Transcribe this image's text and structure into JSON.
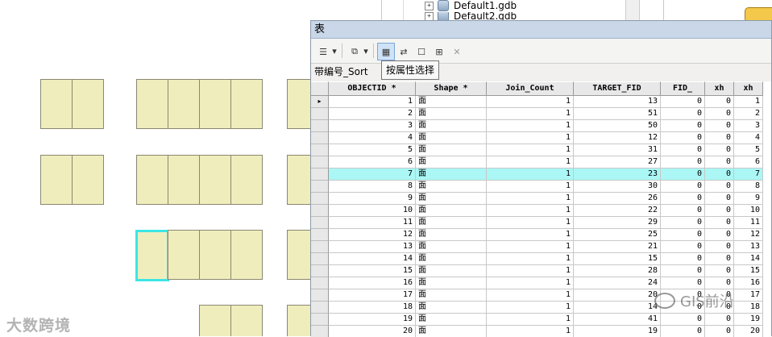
{
  "catalog_tree": {
    "items": [
      {
        "label": "Default1.gdb",
        "expand": "+"
      },
      {
        "label": "Default2.gdb",
        "expand": "+"
      }
    ]
  },
  "table_window": {
    "title": "表",
    "table_name": "带编号_Sort",
    "tooltip": "按属性选择",
    "toolbar": {
      "options_icon": "☰",
      "related_icon": "⧉",
      "dropdown_arrow": "▾",
      "select_by_attributes_icon": "▦",
      "switch_selection_icon": "⇄",
      "clear_selection_icon": "☐",
      "zoom_to_icon": "⊞",
      "delete_icon": "✕"
    },
    "columns": [
      "OBJECTID *",
      "Shape *",
      "Join_Count",
      "TARGET_FID",
      "FID_",
      "xh",
      "xh"
    ],
    "current_row_marker": "▸",
    "selected_row_color": "#aaf7f5",
    "rows": [
      [
        "1",
        "面",
        "1",
        "13",
        "0",
        "0",
        "1"
      ],
      [
        "2",
        "面",
        "1",
        "51",
        "0",
        "0",
        "2"
      ],
      [
        "3",
        "面",
        "1",
        "50",
        "0",
        "0",
        "3"
      ],
      [
        "4",
        "面",
        "1",
        "12",
        "0",
        "0",
        "4"
      ],
      [
        "5",
        "面",
        "1",
        "31",
        "0",
        "0",
        "5"
      ],
      [
        "6",
        "面",
        "1",
        "27",
        "0",
        "0",
        "6"
      ],
      [
        "7",
        "面",
        "1",
        "23",
        "0",
        "0",
        "7"
      ],
      [
        "8",
        "面",
        "1",
        "30",
        "0",
        "0",
        "8"
      ],
      [
        "9",
        "面",
        "1",
        "26",
        "0",
        "0",
        "9"
      ],
      [
        "10",
        "面",
        "1",
        "22",
        "0",
        "0",
        "10"
      ],
      [
        "11",
        "面",
        "1",
        "29",
        "0",
        "0",
        "11"
      ],
      [
        "12",
        "面",
        "1",
        "25",
        "0",
        "0",
        "12"
      ],
      [
        "13",
        "面",
        "1",
        "21",
        "0",
        "0",
        "13"
      ],
      [
        "14",
        "面",
        "1",
        "15",
        "0",
        "0",
        "14"
      ],
      [
        "15",
        "面",
        "1",
        "28",
        "0",
        "0",
        "15"
      ],
      [
        "16",
        "面",
        "1",
        "24",
        "0",
        "0",
        "16"
      ],
      [
        "17",
        "面",
        "1",
        "20",
        "0",
        "0",
        "17"
      ],
      [
        "18",
        "面",
        "1",
        "14",
        "0",
        "0",
        "18"
      ],
      [
        "19",
        "面",
        "1",
        "41",
        "0",
        "0",
        "19"
      ],
      [
        "20",
        "面",
        "1",
        "19",
        "0",
        "0",
        "20"
      ]
    ]
  },
  "map": {
    "parcel_fill": "#f0edbd",
    "selection_color": "#3de5e5"
  },
  "watermarks": {
    "left": "大数跨境",
    "right": "GIS前沿"
  }
}
